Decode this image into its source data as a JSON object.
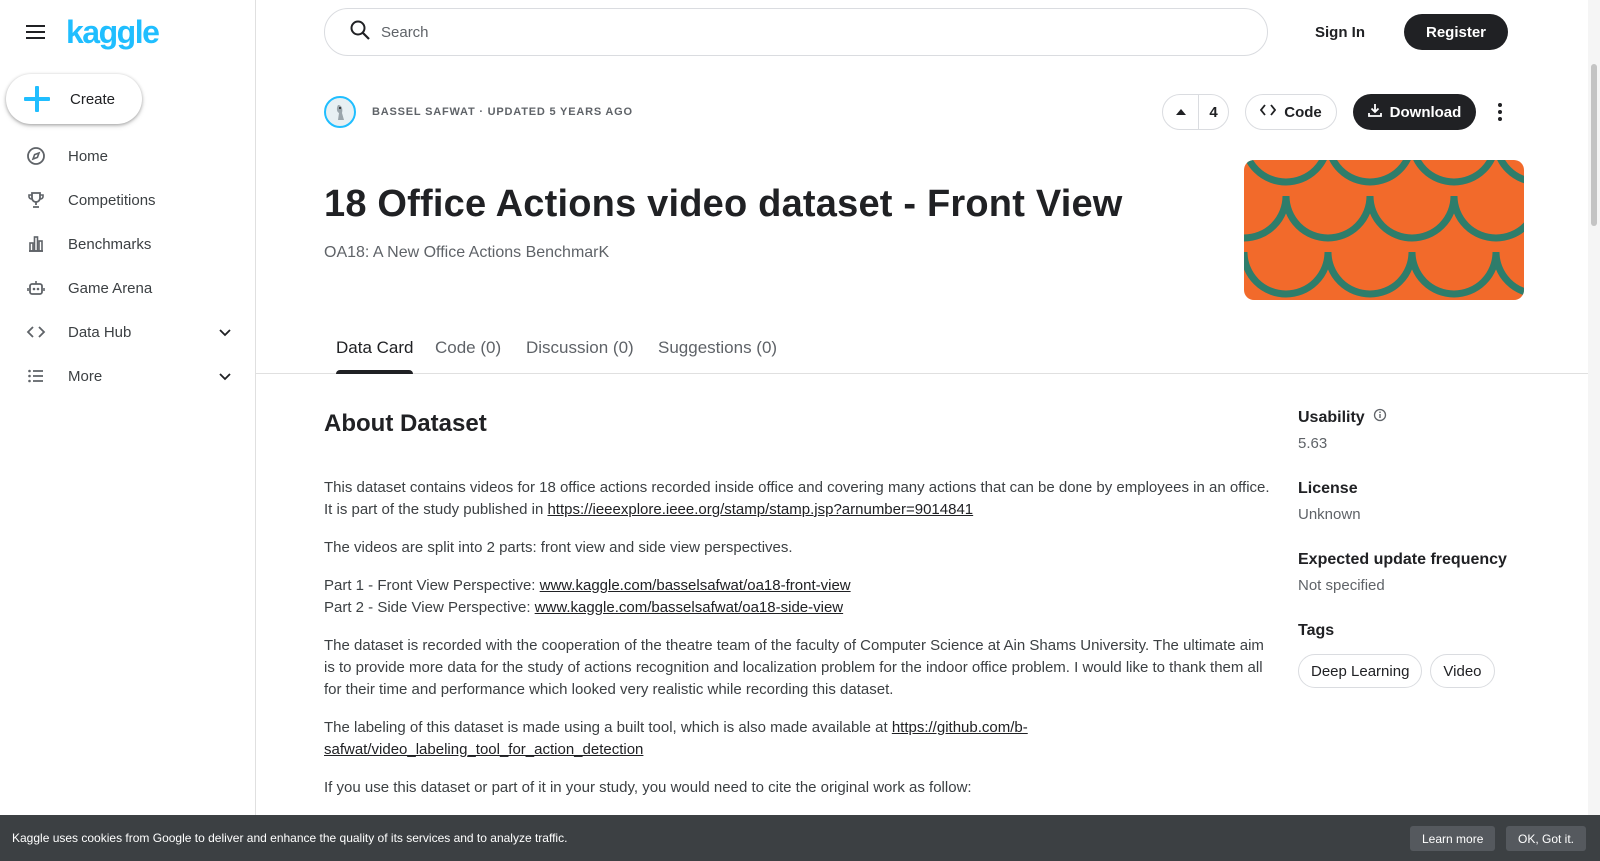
{
  "sidebar": {
    "logo": "kaggle",
    "create_label": "Create",
    "items": [
      {
        "label": "Home",
        "icon": "compass-icon"
      },
      {
        "label": "Competitions",
        "icon": "trophy-icon"
      },
      {
        "label": "Benchmarks",
        "icon": "bar-chart-icon"
      },
      {
        "label": "Game Arena",
        "icon": "robot-icon"
      },
      {
        "label": "Data Hub",
        "icon": "code-brackets-icon",
        "expandable": true
      },
      {
        "label": "More",
        "icon": "list-icon",
        "expandable": true
      }
    ]
  },
  "header": {
    "search_placeholder": "Search",
    "signin_label": "Sign In",
    "register_label": "Register"
  },
  "dataset": {
    "owner_line": "BASSEL SAFWAT · UPDATED 5 YEARS AGO",
    "vote_count": "4",
    "code_label": "Code",
    "download_label": "Download",
    "title": "18 Office Actions video dataset - Front View",
    "subtitle": "OA18: A New Office Actions BenchmarK"
  },
  "tabs": [
    {
      "label": "Data Card",
      "active": true
    },
    {
      "label": "Code (0)",
      "active": false
    },
    {
      "label": "Discussion (0)",
      "active": false
    },
    {
      "label": "Suggestions (0)",
      "active": false
    }
  ],
  "about": {
    "heading": "About Dataset",
    "p1_text": "This dataset contains videos for 18 office actions recorded inside office and covering many actions that can be done by employees in an office. It is part of the study published in ",
    "p1_link": "https://ieeexplore.ieee.org/stamp/stamp.jsp?arnumber=9014841",
    "p2_text": "The videos are split into 2 parts: front view and side view perspectives.",
    "p3_line1_text": "Part 1 - Front View Perspective: ",
    "p3_line1_link": "www.kaggle.com/basselsafwat/oa18-front-view",
    "p3_line2_text": "Part 2 - Side View Perspective: ",
    "p3_line2_link": "www.kaggle.com/basselsafwat/oa18-side-view",
    "p4_text": "The dataset is recorded with the cooperation of the theatre team of the faculty of Computer Science at Ain Shams University. The ultimate aim is to provide more data for the study of actions recognition and localization problem for the indoor office problem. I would like to thank them all for their time and performance which looked very realistic while recording this dataset.",
    "p5_text": "The labeling of this dataset is made using a built tool, which is also made available at ",
    "p5_link": "https://github.com/b-safwat/video_labeling_tool_for_action_detection",
    "p6_text": "If you use this dataset or part of it in your study, you would need to cite the original work as follow:"
  },
  "meta": {
    "usability_label": "Usability",
    "usability_value": "5.63",
    "license_label": "License",
    "license_value": "Unknown",
    "frequency_label": "Expected update frequency",
    "frequency_value": "Not specified",
    "tags_label": "Tags",
    "tags": [
      "Deep Learning",
      "Video"
    ]
  },
  "cookie": {
    "text": "Kaggle uses cookies from Google to deliver and enhance the quality of its services and to analyze traffic.",
    "learn_more": "Learn more",
    "ok": "OK, Got it."
  },
  "colors": {
    "brand": "#20beff",
    "cover_bg": "#f26a2b",
    "cover_scales": "#2e7d6b"
  }
}
